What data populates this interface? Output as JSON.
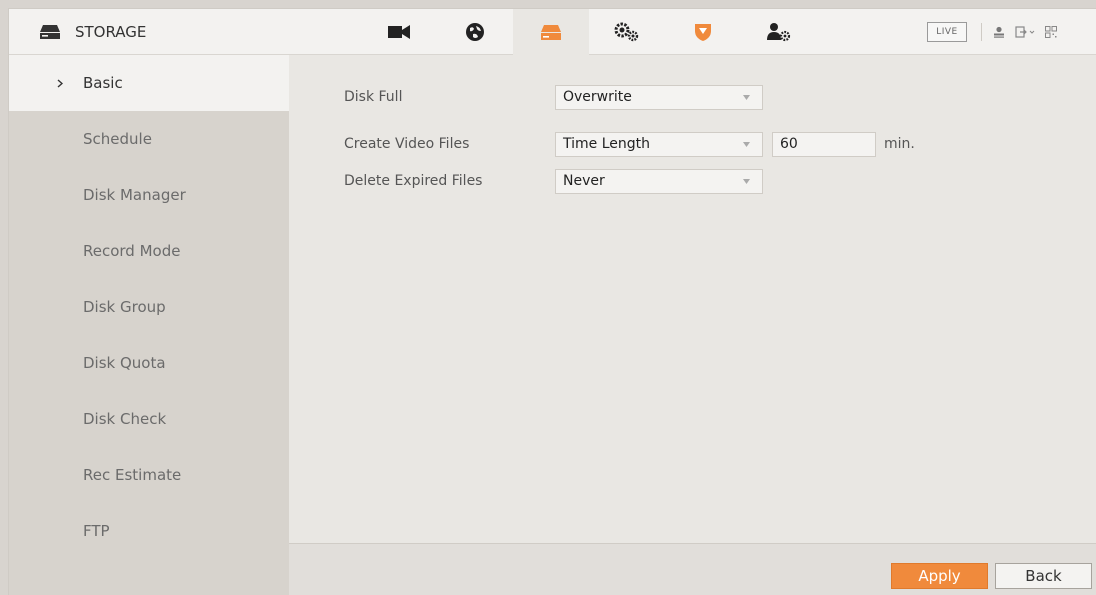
{
  "header": {
    "brand_label": "STORAGE",
    "live_label": "LIVE",
    "nav_tabs": [
      {
        "icon": "camera-icon",
        "active": false
      },
      {
        "icon": "network-globe-icon",
        "active": false
      },
      {
        "icon": "storage-icon",
        "active": true
      },
      {
        "icon": "system-gears-icon",
        "active": false
      },
      {
        "icon": "security-shield-icon",
        "active": false
      },
      {
        "icon": "account-settings-icon",
        "active": false
      }
    ],
    "right_icons": [
      "user-icon",
      "logout-icon",
      "qr-code-icon"
    ]
  },
  "sidebar": {
    "items": [
      {
        "label": "Basic",
        "active": true
      },
      {
        "label": "Schedule",
        "active": false
      },
      {
        "label": "Disk Manager",
        "active": false
      },
      {
        "label": "Record Mode",
        "active": false
      },
      {
        "label": "Disk Group",
        "active": false
      },
      {
        "label": "Disk Quota",
        "active": false
      },
      {
        "label": "Disk Check",
        "active": false
      },
      {
        "label": "Rec Estimate",
        "active": false
      },
      {
        "label": "FTP",
        "active": false
      }
    ]
  },
  "form": {
    "disk_full": {
      "label": "Disk Full",
      "value": "Overwrite"
    },
    "create_video_files": {
      "label": "Create Video Files",
      "value": "Time Length",
      "length": "60",
      "unit": "min."
    },
    "delete_expired_files": {
      "label": "Delete Expired Files",
      "value": "Never"
    }
  },
  "footer": {
    "apply_label": "Apply",
    "back_label": "Back"
  },
  "colors": {
    "accent": "#f08a3c",
    "sidebar_bg": "#d7d3cd",
    "content_bg": "#e9e7e3"
  }
}
